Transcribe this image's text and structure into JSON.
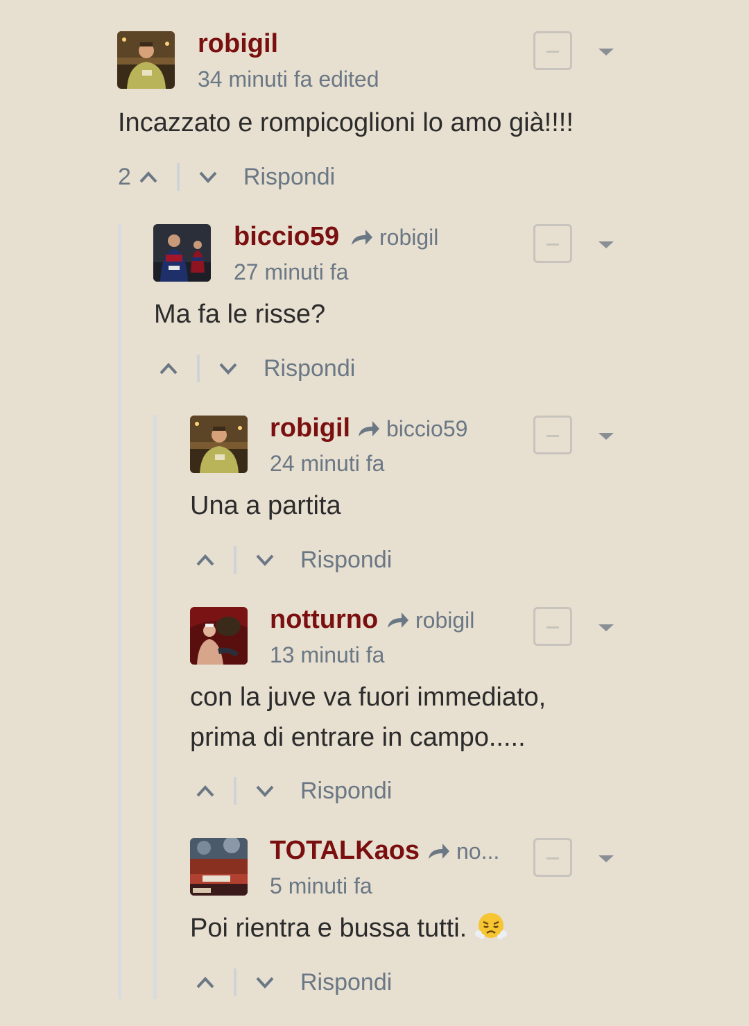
{
  "comments": [
    {
      "username": "robigil",
      "reply_to": "",
      "timestamp": "34 minuti fa edited",
      "text": "Incazzato e rompicoglioni lo amo già!!!!",
      "votes": "2",
      "reply_label": "Rispondi",
      "avatar": "man-yellow-shirt-night-plaza"
    },
    {
      "username": "biccio59",
      "reply_to": "robigil",
      "timestamp": "27 minuti fa",
      "text": "Ma fa le risse?",
      "votes": "",
      "reply_label": "Rispondi",
      "avatar": "footballers-red-blue-kits"
    },
    {
      "username": "robigil",
      "reply_to": "biccio59",
      "timestamp": "24 minuti fa",
      "text": "Una a partita",
      "votes": "",
      "reply_label": "Rispondi",
      "avatar": "man-yellow-shirt-night-plaza"
    },
    {
      "username": "notturno",
      "reply_to": "robigil",
      "timestamp": "13 minuti fa",
      "text_lines": [
        "con la juve va fuori immediato,",
        "prima di entrare in campo....."
      ],
      "votes": "",
      "reply_label": "Rispondi",
      "avatar": "man-on-red-sofa"
    },
    {
      "username": "TOTALKaos",
      "reply_to": "no...",
      "timestamp": "5 minuti fa",
      "text": "Poi rientra e bussa tutti.",
      "emoji": "face-with-steam-from-nose",
      "votes": "",
      "reply_label": "Rispondi",
      "avatar": "stadium-crowd-banners"
    }
  ],
  "colors": {
    "background": "#e7dfd0",
    "username": "#7a0f0f",
    "meta": "#6a7784",
    "text": "#2b2b2b",
    "thread_line": "#d9dcdf"
  }
}
